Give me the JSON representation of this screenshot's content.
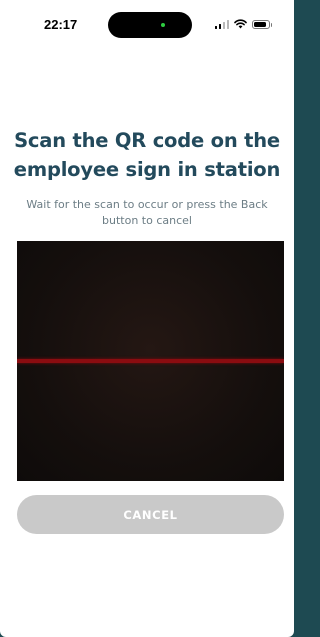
{
  "status_bar": {
    "time": "22:17",
    "icons": [
      "cellular-signal-icon",
      "wifi-icon",
      "battery-icon"
    ]
  },
  "scan_screen": {
    "title_line1": "Scan the QR code on the",
    "title_line2": "employee sign in station",
    "instructions_line1": "Wait for the scan to occur or press the Back",
    "instructions_line2": "button to cancel",
    "cancel_label": "CANCEL"
  },
  "colors": {
    "title": "#234a5c",
    "scan_line": "#8a0c10",
    "button_bg": "#c9c9c9",
    "frame_bg": "#1e4a52"
  }
}
